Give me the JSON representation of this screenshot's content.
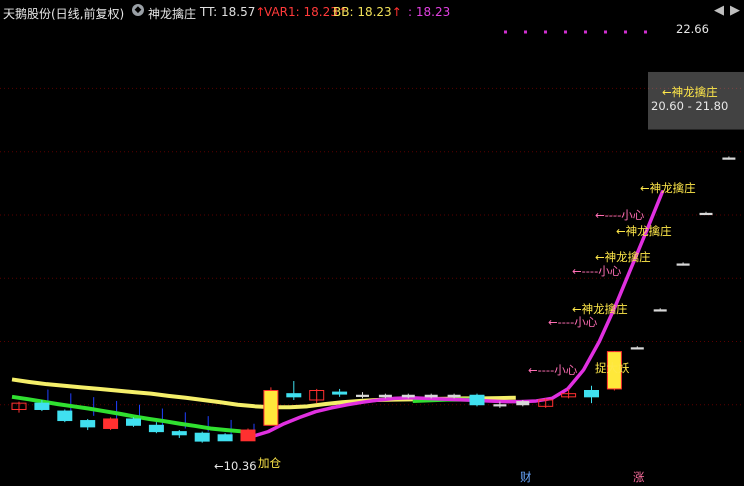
{
  "header": {
    "stock": "天鹅股份(日线,前复权)",
    "indicator_name": "神龙擒庄",
    "tt_label": "TT: 18.57",
    "var1_label": "VAR1: 18.23",
    "bb_label": "BB: 18.23",
    "fourth_label": ": 18.23",
    "up_arrow": "↑",
    "dot_glyph": "◆",
    "nav_left": "◀",
    "nav_right": "▶"
  },
  "annotations": {
    "high_price": "22.66",
    "range_label": "20.60 - 21.80",
    "low_price": "←10.36",
    "add_position": "加仓",
    "capture_demon": "捉大妖",
    "bottom_cai": "财",
    "bottom_zhang": "涨",
    "signal_long": [
      "←神龙擒庄",
      "←神龙擒庄",
      "←神龙擒庄",
      "←神龙擒庄",
      "←神龙擒庄"
    ],
    "signal_caution": [
      "←----小心",
      "←----小心",
      "←----小心",
      "←----小心"
    ]
  },
  "colors": {
    "background": "#000000",
    "grid": "#5a0000",
    "up": "#ff3030",
    "down": "#40e0f0",
    "yellow_bar": "#ffe83a",
    "yellow_line": "#f5ef6a",
    "green_line": "#30e030",
    "magenta_line": "#e030e0",
    "magenta_dot": "#d030d0",
    "blue_bar": "#2040ff"
  },
  "chart_data": {
    "type": "candlestick",
    "title": "天鹅股份(日线,前复权)",
    "subtitle": "神龙擒庄",
    "ylim": [
      9.5,
      23.6
    ],
    "candles": [
      {
        "open": 11.55,
        "close": 11.35,
        "high": 11.6,
        "low": 11.25,
        "color": "up-hollow"
      },
      {
        "open": 11.55,
        "close": 11.35,
        "high": 11.65,
        "low": 11.3,
        "color": "down"
      },
      {
        "open": 11.3,
        "close": 11.0,
        "high": 11.35,
        "low": 10.95,
        "color": "down"
      },
      {
        "open": 11.0,
        "close": 10.8,
        "high": 11.05,
        "low": 10.7,
        "color": "down"
      },
      {
        "open": 10.75,
        "close": 11.05,
        "high": 11.1,
        "low": 10.7,
        "color": "up-solid"
      },
      {
        "open": 10.85,
        "close": 11.05,
        "high": 11.1,
        "low": 10.8,
        "color": "down"
      },
      {
        "open": 10.85,
        "close": 10.65,
        "high": 10.95,
        "low": 10.6,
        "color": "down"
      },
      {
        "open": 10.65,
        "close": 10.55,
        "high": 10.7,
        "low": 10.45,
        "color": "down"
      },
      {
        "open": 10.6,
        "close": 10.35,
        "high": 10.65,
        "low": 10.3,
        "color": "down"
      },
      {
        "open": 10.55,
        "close": 10.36,
        "high": 10.6,
        "low": 10.36,
        "color": "down"
      },
      {
        "open": 10.36,
        "close": 10.7,
        "high": 10.75,
        "low": 10.36,
        "color": "up-solid"
      },
      {
        "open": 10.85,
        "close": 11.95,
        "high": 12.05,
        "low": 10.85,
        "color": "yellow"
      },
      {
        "open": 11.75,
        "close": 11.85,
        "high": 12.25,
        "low": 11.65,
        "color": "down"
      },
      {
        "open": 11.65,
        "close": 11.95,
        "high": 12.0,
        "low": 11.55,
        "color": "up-hollow"
      },
      {
        "open": 11.85,
        "close": 11.9,
        "high": 12.0,
        "low": 11.75,
        "color": "down"
      },
      {
        "open": 11.8,
        "close": 11.8,
        "high": 11.9,
        "low": 11.7,
        "color": "doji"
      },
      {
        "open": 11.8,
        "close": 11.75,
        "high": 11.85,
        "low": 11.7,
        "color": "doji"
      },
      {
        "open": 11.75,
        "close": 11.8,
        "high": 11.85,
        "low": 11.7,
        "color": "doji"
      },
      {
        "open": 11.8,
        "close": 11.75,
        "high": 11.85,
        "low": 11.7,
        "color": "doji"
      },
      {
        "open": 11.75,
        "close": 11.8,
        "high": 11.85,
        "low": 11.7,
        "color": "doji"
      },
      {
        "open": 11.8,
        "close": 11.5,
        "high": 11.85,
        "low": 11.45,
        "color": "down"
      },
      {
        "open": 11.5,
        "close": 11.5,
        "high": 11.6,
        "low": 11.4,
        "color": "doji"
      },
      {
        "open": 11.5,
        "close": 11.6,
        "high": 11.65,
        "low": 11.45,
        "color": "doji"
      },
      {
        "open": 11.45,
        "close": 11.65,
        "high": 11.7,
        "low": 11.4,
        "color": "up-hollow"
      },
      {
        "open": 11.75,
        "close": 11.85,
        "high": 12.0,
        "low": 11.7,
        "color": "up-hollow"
      },
      {
        "open": 11.75,
        "close": 11.95,
        "high": 12.1,
        "low": 11.55,
        "color": "down"
      },
      {
        "open": 12.0,
        "close": 13.18,
        "high": 13.2,
        "low": 11.95,
        "color": "yellow"
      },
      {
        "open": 13.3,
        "close": 13.3,
        "high": 13.35,
        "low": 13.25,
        "color": "doji"
      },
      {
        "open": 14.5,
        "close": 14.5,
        "high": 14.55,
        "low": 14.45,
        "color": "doji"
      },
      {
        "open": 15.95,
        "close": 15.95,
        "high": 16.0,
        "low": 15.9,
        "color": "doji"
      },
      {
        "open": 17.55,
        "close": 17.55,
        "high": 17.6,
        "low": 17.5,
        "color": "doji"
      },
      {
        "open": 19.3,
        "close": 19.3,
        "high": 19.35,
        "low": 19.25,
        "color": "doji"
      },
      {
        "open": 19.3,
        "close": 19.3,
        "high": 19.35,
        "low": 19.25,
        "color": "doji"
      },
      {
        "open": 20.6,
        "close": 21.8,
        "high": 21.85,
        "low": 20.55,
        "color": "yellow"
      },
      {
        "open": 21.85,
        "close": 22.66,
        "high": 22.66,
        "low": 21.85,
        "color": "yellow"
      }
    ],
    "yellow_line": [
      12.3,
      12.22,
      12.15,
      12.1,
      12.05,
      12.0,
      11.95,
      11.9,
      11.85,
      11.78,
      11.72,
      11.65,
      11.58,
      11.5,
      11.45,
      11.42,
      11.42,
      11.45,
      11.52,
      11.58,
      11.62,
      11.65,
      11.66,
      11.67,
      11.68,
      11.69,
      11.7,
      11.7,
      11.71,
      11.72
    ],
    "green_line": [
      11.75,
      11.68,
      11.6,
      11.52,
      11.45,
      11.38,
      11.3,
      11.22,
      11.13,
      11.05,
      10.98,
      10.9,
      10.83,
      10.75,
      10.7,
      10.66
    ],
    "magenta_line": [
      10.5,
      10.65,
      10.9,
      11.1,
      11.28,
      11.4,
      11.5,
      11.58,
      11.65,
      11.7,
      11.72,
      11.7,
      11.68,
      11.66,
      11.64,
      11.62,
      11.6,
      11.6,
      11.62,
      11.7,
      12.0,
      12.6,
      13.5,
      14.6,
      15.8,
      17.0,
      18.23
    ],
    "magenta_dot_level": 23.3
  }
}
